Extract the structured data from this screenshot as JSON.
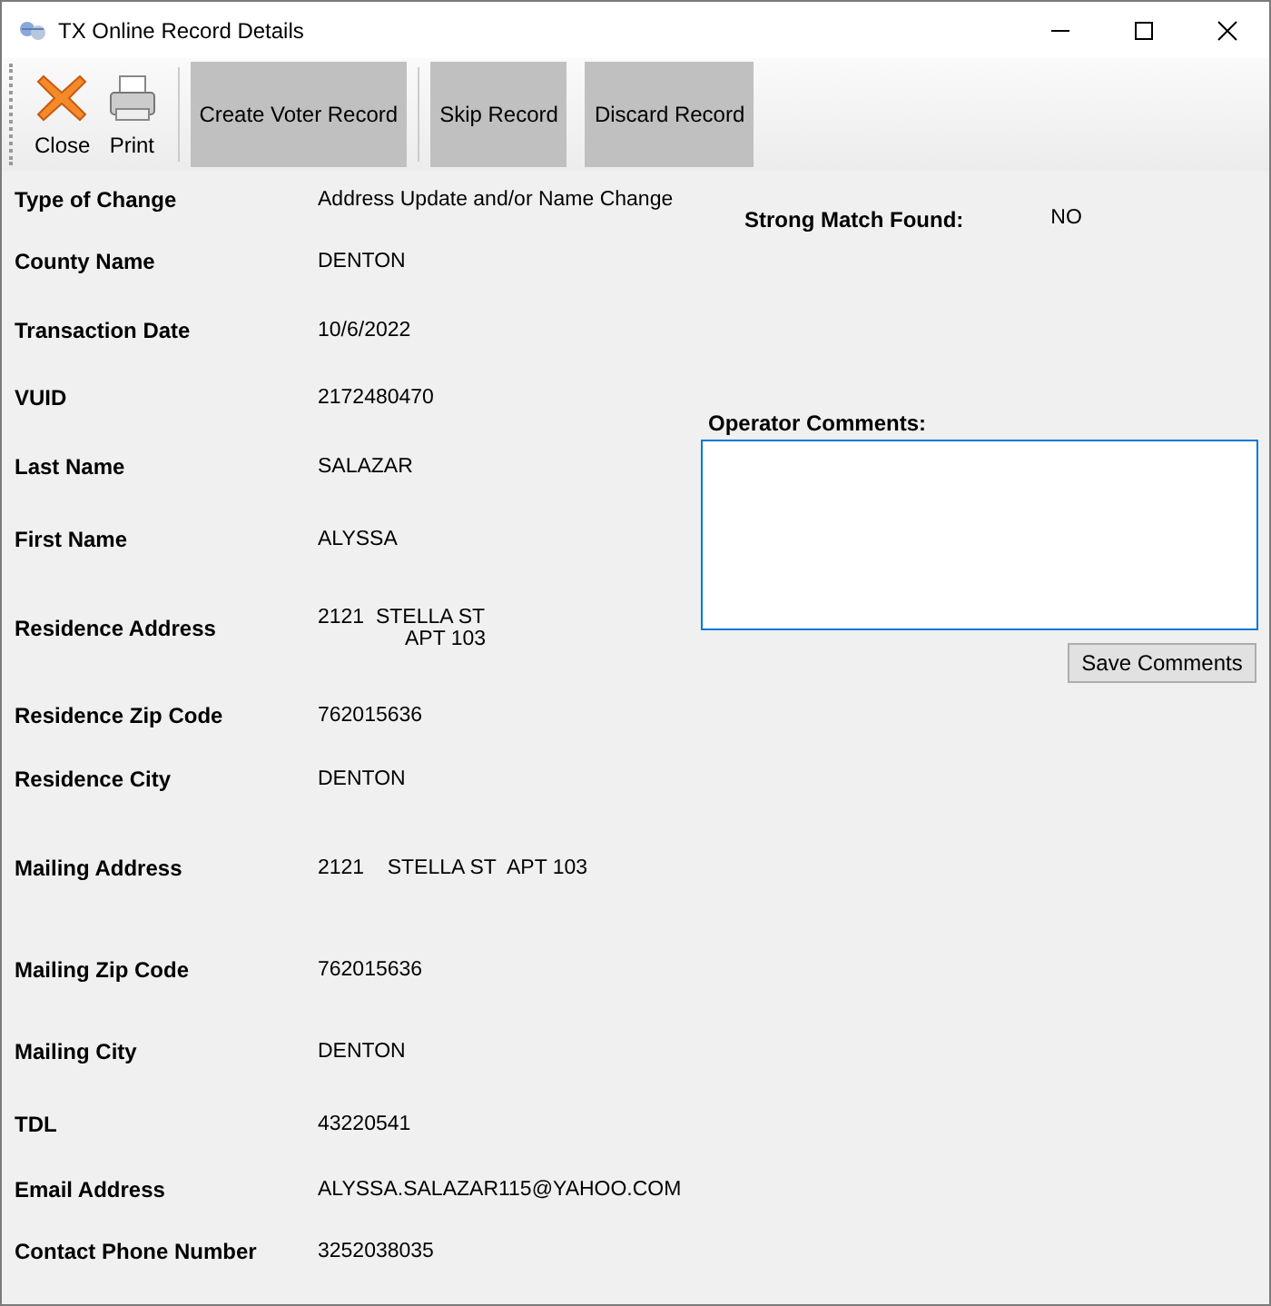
{
  "window": {
    "title": "TX Online Record Details"
  },
  "toolbar": {
    "tools": [
      {
        "label": "Close",
        "kind": "close"
      },
      {
        "label": "Print",
        "kind": "print"
      }
    ],
    "buttons": [
      "Create Voter Record",
      "Skip Record",
      "Discard Record"
    ]
  },
  "fields": [
    {
      "label": "Type of Change",
      "value": [
        "Address Update and/or Name Change"
      ]
    },
    {
      "label": "County Name",
      "value": [
        "DENTON"
      ]
    },
    {
      "label": "Transaction Date",
      "value": [
        "10/6/2022"
      ]
    },
    {
      "label": "VUID",
      "value": [
        "2172480470"
      ]
    },
    {
      "label": "Last Name",
      "value": [
        "SALAZAR"
      ]
    },
    {
      "label": "First Name",
      "value": [
        "ALYSSA"
      ]
    },
    {
      "label": "Residence Address",
      "value": [
        "2121  STELLA ST",
        "APT 103"
      ]
    },
    {
      "label": "Residence Zip Code",
      "value": [
        "762015636"
      ]
    },
    {
      "label": "Residence City",
      "value": [
        "DENTON"
      ]
    },
    {
      "label": "Mailing Address",
      "value": [
        "2121    STELLA ST  APT 103"
      ]
    },
    {
      "label": "Mailing Zip Code",
      "value": [
        "762015636"
      ]
    },
    {
      "label": "Mailing City",
      "value": [
        "DENTON"
      ]
    },
    {
      "label": "TDL",
      "value": [
        "43220541"
      ]
    },
    {
      "label": "Email Address",
      "value": [
        "ALYSSA.SALAZAR115@YAHOO.COM"
      ]
    },
    {
      "label": "Contact Phone Number",
      "value": [
        "3252038035"
      ]
    }
  ],
  "strong_match": {
    "label": "Strong Match Found:",
    "value": "NO"
  },
  "comments": {
    "label": "Operator Comments:",
    "button": "Save Comments"
  }
}
